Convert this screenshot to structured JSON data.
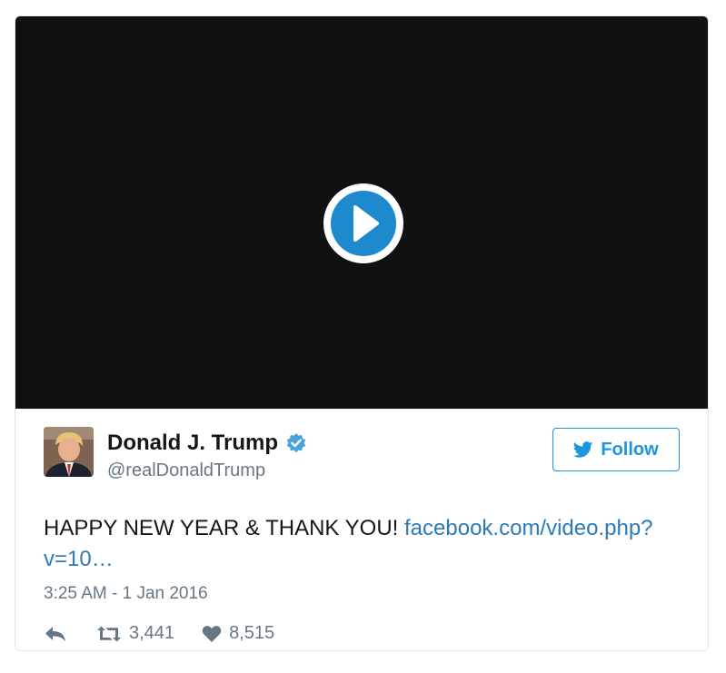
{
  "video": {
    "play_icon": "play-icon"
  },
  "author": {
    "name": "Donald J. Trump",
    "handle": "@realDonaldTrump",
    "verified_icon": "verified-badge-icon",
    "avatar_icon": "avatar-photo"
  },
  "follow": {
    "label": "Follow",
    "icon": "twitter-bird-icon"
  },
  "tweet": {
    "text": "HAPPY NEW YEAR & THANK YOU! ",
    "link_line1": "facebook.com/video.php?",
    "link_line2": "v=10…"
  },
  "timestamp": "3:25 AM - 1 Jan 2016",
  "actions": {
    "reply_icon": "reply-icon",
    "retweet_icon": "retweet-icon",
    "retweet_count": "3,441",
    "like_icon": "heart-icon",
    "like_count": "8,515"
  },
  "colors": {
    "accent": "#1b95e0",
    "link": "#2b7bb9",
    "muted": "#657786",
    "text": "#14171a",
    "video_bg": "#111111"
  }
}
